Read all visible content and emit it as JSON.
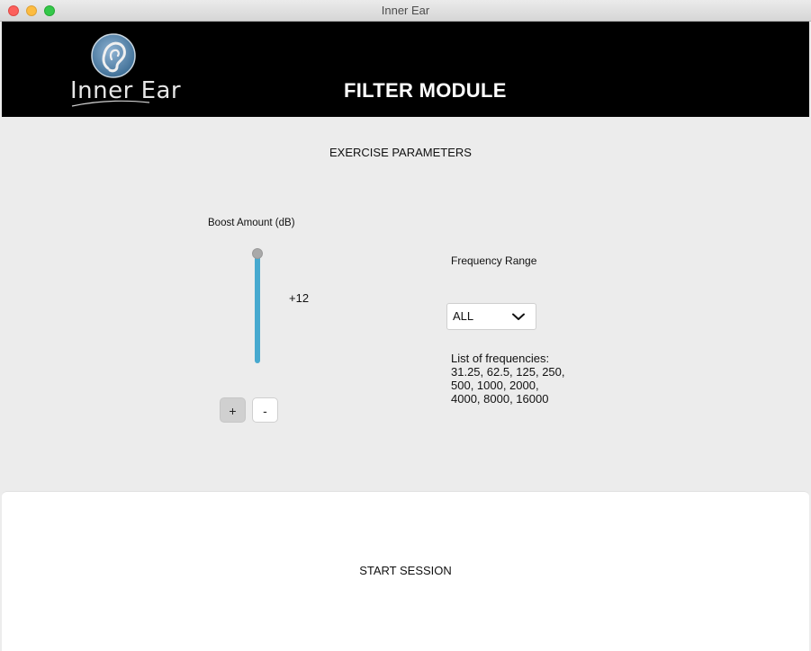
{
  "window": {
    "title": "Inner Ear",
    "controls": [
      "close",
      "minimize",
      "maximize"
    ]
  },
  "header": {
    "logo_text": "Inner Ear",
    "logo_icon": "ear-icon",
    "module_title": "FILTER MODULE"
  },
  "parameters": {
    "section_title": "EXERCISE PARAMETERS",
    "boost": {
      "label": "Boost Amount (dB)",
      "value_text": "+12",
      "level": 1.0,
      "plus_label": "+",
      "minus_label": "-"
    },
    "frequency": {
      "label": "Frequency Range",
      "selected": "ALL",
      "list_heading": "List of frequencies:",
      "list_values": "31.25, 62.5, 125, 250, 500, 1000, 2000, 4000, 8000, 16000"
    }
  },
  "footer": {
    "start_label": "START SESSION"
  },
  "colors": {
    "accent": "#47a9cf",
    "header_bg": "#000000",
    "panel_bg": "#ececec"
  }
}
